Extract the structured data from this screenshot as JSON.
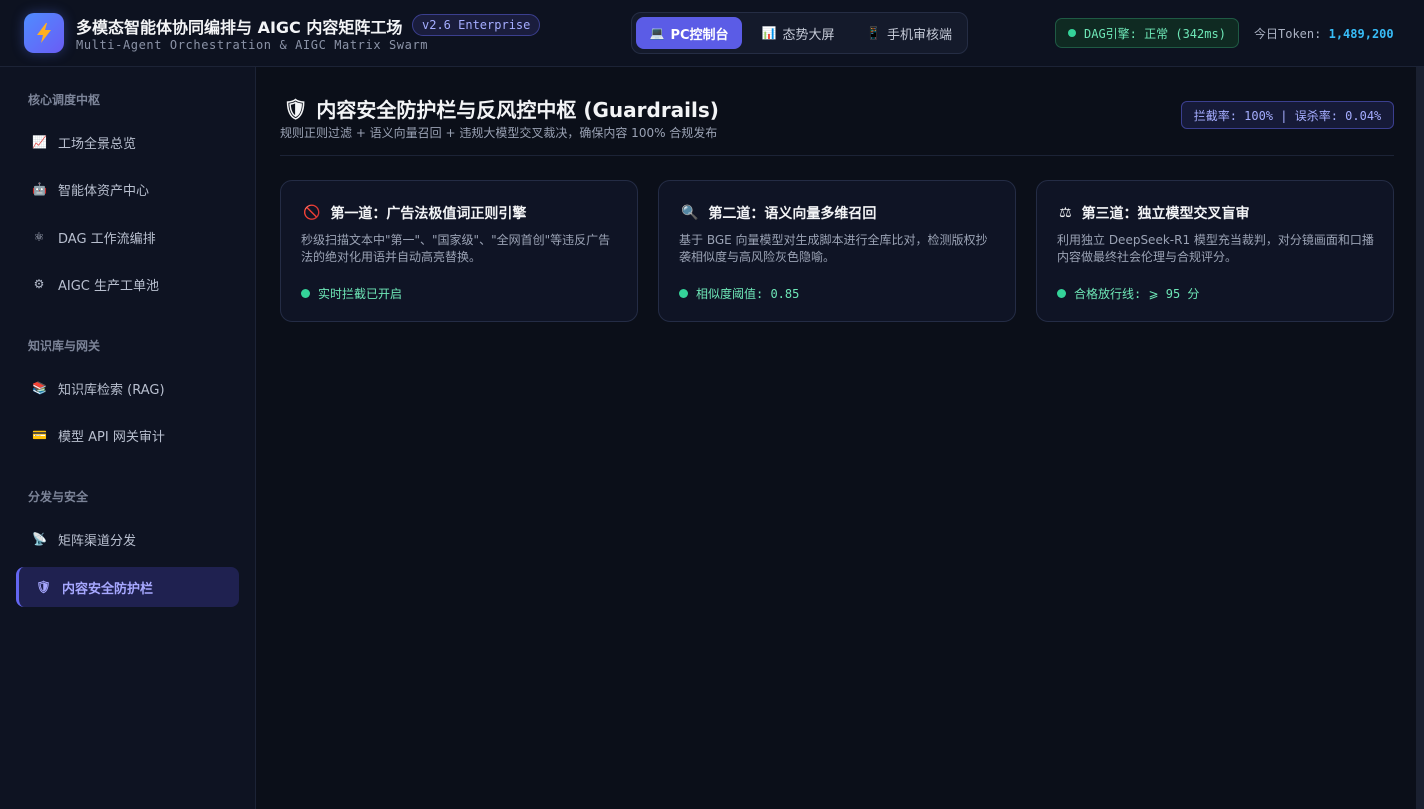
{
  "header": {
    "title": "多模态智能体协同编排与 AIGC 内容矩阵工场",
    "subtitle": "Multi-Agent Orchestration & AIGC Matrix Swarm",
    "version": "v2.6 Enterprise",
    "logo_icon": "lightning-bolt-icon",
    "view_tabs": [
      {
        "label": "PC控制台",
        "icon": "💻",
        "active": true
      },
      {
        "label": "态势大屏",
        "icon": "📊",
        "active": false
      },
      {
        "label": "手机审核端",
        "icon": "📱",
        "active": false
      }
    ],
    "engine_status": "DAG引擎: 正常 (342ms)",
    "token_label": "今日Token:",
    "token_value": "1,489,200"
  },
  "sidebar": {
    "groups": [
      {
        "label": "核心调度中枢",
        "items": [
          {
            "label": "工场全景总览",
            "icon": "📈"
          },
          {
            "label": "智能体资产中心",
            "icon": "🤖"
          },
          {
            "label": "DAG 工作流编排",
            "icon": "⚛"
          },
          {
            "label": "AIGC 生产工单池",
            "icon": "⚙"
          }
        ]
      },
      {
        "label": "知识库与网关",
        "items": [
          {
            "label": "知识库检索 (RAG)",
            "icon": "📚"
          },
          {
            "label": "模型 API 网关审计",
            "icon": "💳"
          }
        ]
      },
      {
        "label": "分发与安全",
        "items": [
          {
            "label": "矩阵渠道分发",
            "icon": "📡"
          },
          {
            "label": "内容安全防护栏",
            "icon": "🛡",
            "active": true
          }
        ]
      }
    ]
  },
  "main": {
    "title": "内容安全防护栏与反风控中枢 (Guardrails)",
    "title_icon": "🛡",
    "description": "规则正则过滤 + 语义向量召回 + 违规大模型交叉裁决，确保内容 100% 合规发布",
    "rate_badge": "拦截率: 100% | 误杀率: 0.04%",
    "cards": [
      {
        "icon": "🚫",
        "title": "第一道：广告法极值词正则引擎",
        "desc": "秒级扫描文本中\"第一\"、\"国家级\"、\"全网首创\"等违反广告法的绝对化用语并自动高亮替换。",
        "status": "实时拦截已开启"
      },
      {
        "icon": "🔍",
        "title": "第二道：语义向量多维召回",
        "desc": "基于 BGE 向量模型对生成脚本进行全库比对，检测版权抄袭相似度与高风险灰色隐喻。",
        "status": "相似度阈值: 0.85"
      },
      {
        "icon": "⚖",
        "title": "第三道：独立模型交叉盲审",
        "desc": "利用独立 DeepSeek-R1 模型充当裁判，对分镜画面和口播内容做最终社会伦理与合规评分。",
        "status": "合格放行线: ⩾ 95 分"
      }
    ]
  }
}
